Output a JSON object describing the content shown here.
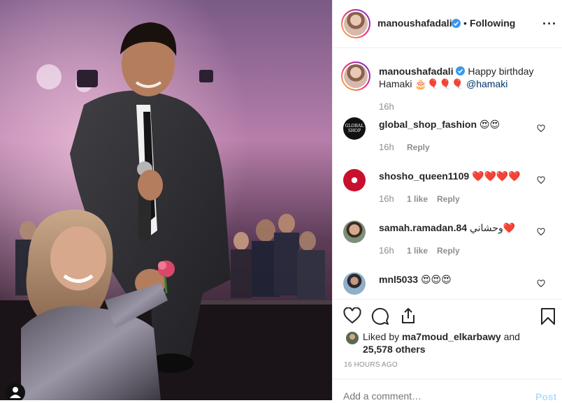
{
  "post": {
    "username": "manoushafadali",
    "follow_state": "Following",
    "separator": "•",
    "caption_lead": "Happy birthday",
    "caption_name": "Hamaki",
    "caption_emojis": "🎂🎈🎈🎈",
    "caption_mention": "@hamaki",
    "caption_time": "16h"
  },
  "comments": [
    {
      "user": "global_shop_fashion",
      "text": "😍😍",
      "time": "16h",
      "likes": "",
      "reply": "Reply",
      "avatar_text": "GLOBAL SHOP"
    },
    {
      "user": "shosho_queen1109",
      "text": "❤️❤️❤️❤️",
      "time": "16h",
      "likes": "1 like",
      "reply": "Reply"
    },
    {
      "user": "samah.ramadan.84",
      "text": "وحشاني❤️",
      "time": "16h",
      "likes": "1 like",
      "reply": "Reply"
    },
    {
      "user": "mnl5033",
      "text": "😍😍😍",
      "time": "",
      "likes": "",
      "reply": ""
    }
  ],
  "likes": {
    "prefix": "Liked by",
    "user": "ma7moud_elkarbawy",
    "middle": "and",
    "count": "25,578 others"
  },
  "timestamp": "16 HOURS AGO",
  "add_comment": {
    "placeholder": "Add a comment…",
    "post_label": "Post"
  },
  "colors": {
    "accent": "#0095f6",
    "verified": "#3897f0",
    "muted": "#8e8e8e"
  }
}
